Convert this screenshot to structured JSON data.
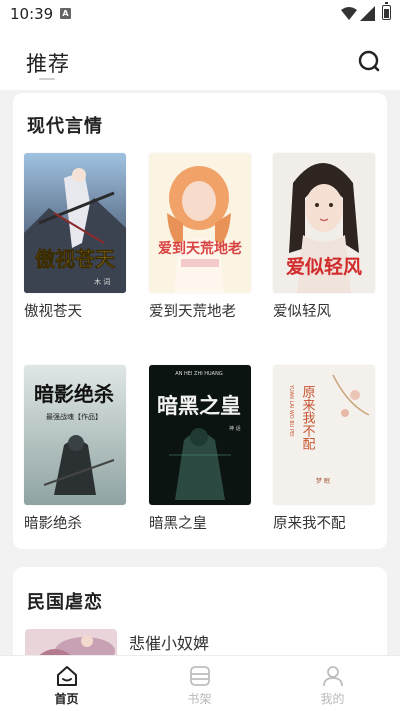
{
  "status_bar": {
    "time": "10:39",
    "notification_letter": "A"
  },
  "header": {
    "title": "推荐",
    "search_icon": "search-icon"
  },
  "sections": [
    {
      "title": "现代言情",
      "books": [
        {
          "title": "傲视苍天",
          "cover_text": "傲视苍天"
        },
        {
          "title": "爱到天荒地老",
          "cover_text": "爱到天荒地老"
        },
        {
          "title": "爱似轻风",
          "cover_text": "爱似轻风"
        },
        {
          "title": "暗影绝杀",
          "cover_text": "暗影绝杀"
        },
        {
          "title": "暗黑之皇",
          "cover_text": "暗黑之皇"
        },
        {
          "title": "原来我不配",
          "cover_text": "原来我不配"
        }
      ]
    },
    {
      "title": "民国虐恋",
      "items": [
        {
          "title": "悲催小奴婢"
        }
      ]
    }
  ],
  "tabbar": {
    "items": [
      {
        "label": "首页",
        "icon": "home-icon",
        "active": true
      },
      {
        "label": "书架",
        "icon": "bookshelf-icon",
        "active": false
      },
      {
        "label": "我的",
        "icon": "profile-icon",
        "active": false
      }
    ],
    "active_color": "#222222",
    "inactive_color": "#b9b9b9"
  }
}
